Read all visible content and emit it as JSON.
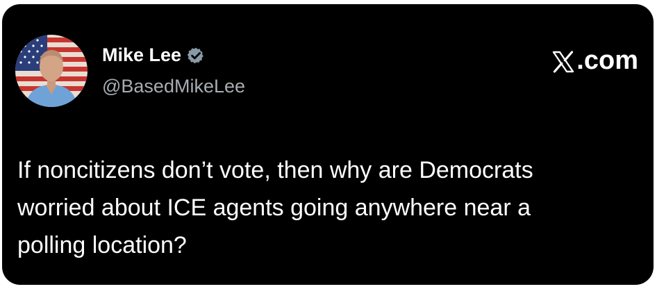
{
  "author": {
    "display_name": "Mike Lee",
    "handle": "@BasedMikeLee",
    "verified_icon": "verified-badge-icon",
    "avatar_icon": "profile-photo"
  },
  "brand": {
    "domain": ".com",
    "logo_icon": "x-logo-icon"
  },
  "tweet": {
    "text": "If noncitizens don’t vote, then why are Democrats\nworried about ICE agents going anywhere near a\npolling location?"
  },
  "colors": {
    "background": "#000000",
    "text": "#ffffff",
    "handle": "#a8adb2",
    "verified": "#8899a6"
  }
}
